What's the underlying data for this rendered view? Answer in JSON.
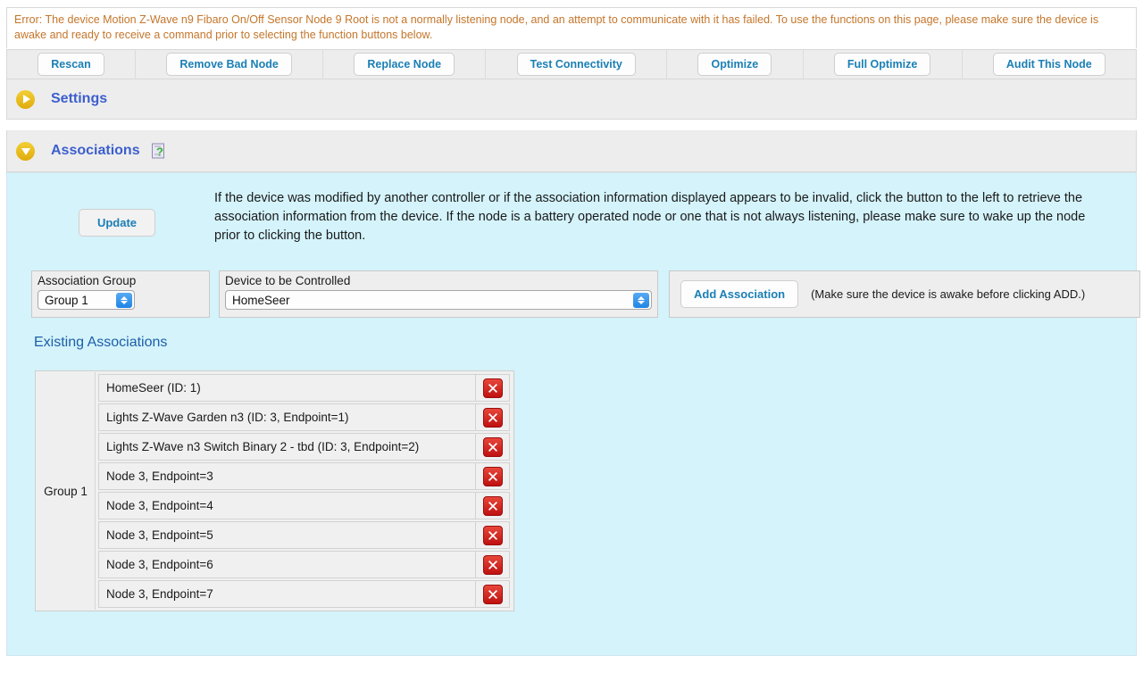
{
  "error": {
    "message": "Error: The device Motion Z-Wave n9 Fibaro On/Off Sensor Node 9 Root is not a normally listening node, and an attempt to communicate with it has failed. To use the functions on this page, please make sure the device is awake and ready to receive a command prior to selecting the function buttons below.",
    "color": "#c4762b"
  },
  "toolbar": {
    "buttons": [
      {
        "label": "Rescan"
      },
      {
        "label": "Remove Bad Node"
      },
      {
        "label": "Replace Node"
      },
      {
        "label": "Test Connectivity"
      },
      {
        "label": "Optimize"
      },
      {
        "label": "Full Optimize"
      },
      {
        "label": "Audit This Node"
      }
    ],
    "link_color": "#1a7fb5"
  },
  "sections": {
    "settings": {
      "title": "Settings",
      "state": "collapsed",
      "twisty_icon": "triangle-right-icon"
    },
    "associations": {
      "title": "Associations",
      "state": "expanded",
      "twisty_icon": "triangle-down-icon",
      "help_icon": "help-document-icon"
    }
  },
  "update": {
    "button_label": "Update",
    "description": "If the device was modified by another controller or if the association information displayed appears to be invalid, click the button to the left to retrieve the association information from the device. If the node is a battery operated node or one that is not always listening, please make sure to wake up the node prior to clicking the button."
  },
  "controls": {
    "group": {
      "label": "Association Group",
      "value": "Group 1"
    },
    "device": {
      "label": "Device to be Controlled",
      "value": "HomeSeer"
    },
    "add_button_label": "Add Association",
    "add_note": "(Make sure the device is awake before clicking ADD.)"
  },
  "existing": {
    "title": "Existing Associations",
    "group_label": "Group 1",
    "delete_icon": "delete-x-icon",
    "rows": [
      {
        "name": "HomeSeer (ID: 1)"
      },
      {
        "name": "Lights Z-Wave Garden n3 (ID: 3, Endpoint=1)"
      },
      {
        "name": "Lights Z-Wave n3 Switch Binary 2 - tbd (ID: 3, Endpoint=2)"
      },
      {
        "name": "Node 3, Endpoint=3"
      },
      {
        "name": "Node 3, Endpoint=4"
      },
      {
        "name": "Node 3, Endpoint=5"
      },
      {
        "name": "Node 3, Endpoint=6"
      },
      {
        "name": "Node 3, Endpoint=7"
      }
    ]
  },
  "theme": {
    "panel_bg": "#d4f3fb",
    "header_bg": "#ededed",
    "accent_blue": "#3c5fcd",
    "danger_red": "#d42020"
  }
}
